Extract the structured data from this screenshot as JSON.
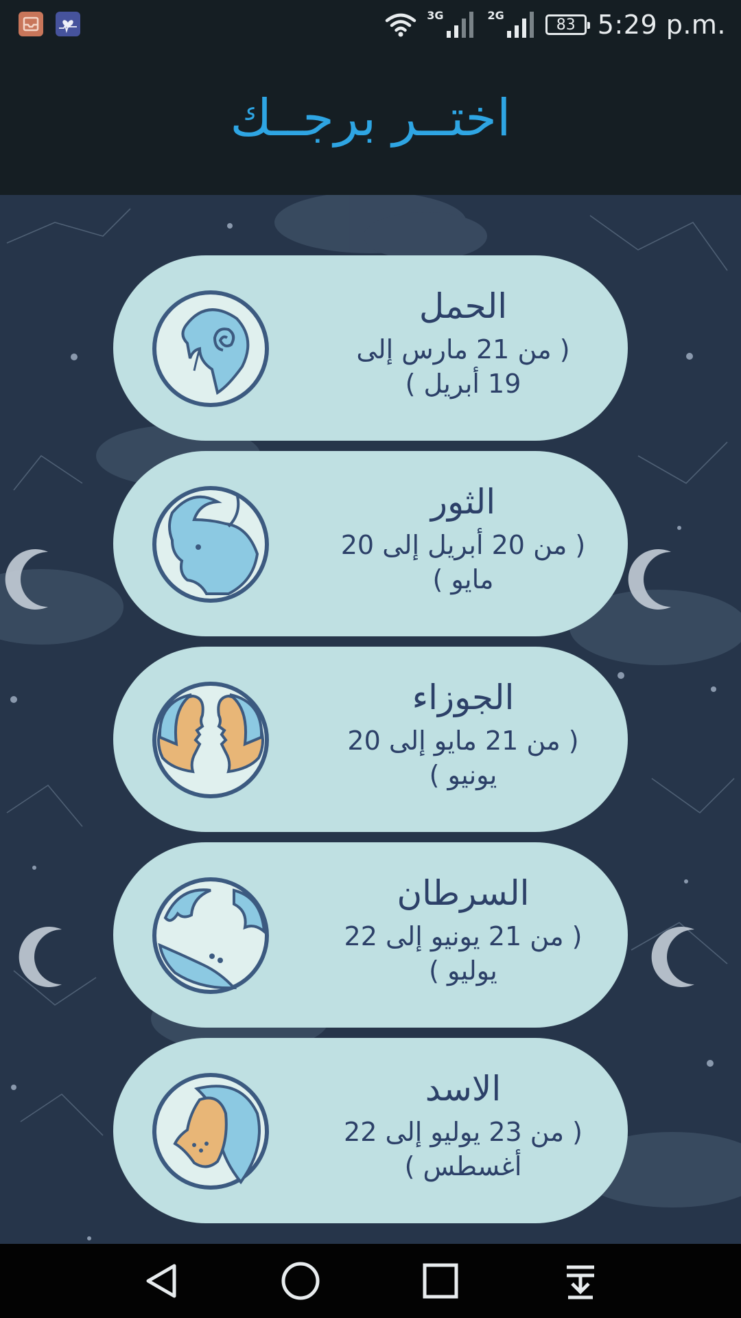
{
  "status_bar": {
    "net1": "3G",
    "net2": "2G",
    "battery": "83",
    "time": "5:29 p.m."
  },
  "header": {
    "title": "اختــر برجــك"
  },
  "signs": [
    {
      "name": "الحمل",
      "dates": "( من 21 مارس إلى 19 أبريل )",
      "icon": "aries-ram-icon"
    },
    {
      "name": "الثور",
      "dates": "( من 20 أبريل إلى 20 مايو )",
      "icon": "taurus-bull-icon"
    },
    {
      "name": "الجوزاء",
      "dates": "( من 21 مايو إلى 20 يونيو )",
      "icon": "gemini-twins-icon"
    },
    {
      "name": "السرطان",
      "dates": "( من 21 يونيو إلى 22 يوليو )",
      "icon": "cancer-crab-icon"
    },
    {
      "name": "الاسد",
      "dates": "( من 23 يوليو إلى 22 أغسطس )",
      "icon": "leo-lion-icon"
    }
  ],
  "nav": [
    "back-icon",
    "home-icon",
    "recents-icon",
    "notification-drawer-icon"
  ],
  "colors": {
    "accent": "#2ea5e3",
    "card": "#bfe0e2",
    "card_text": "#2c4068",
    "background": "#26354a",
    "bar": "#151e23"
  }
}
